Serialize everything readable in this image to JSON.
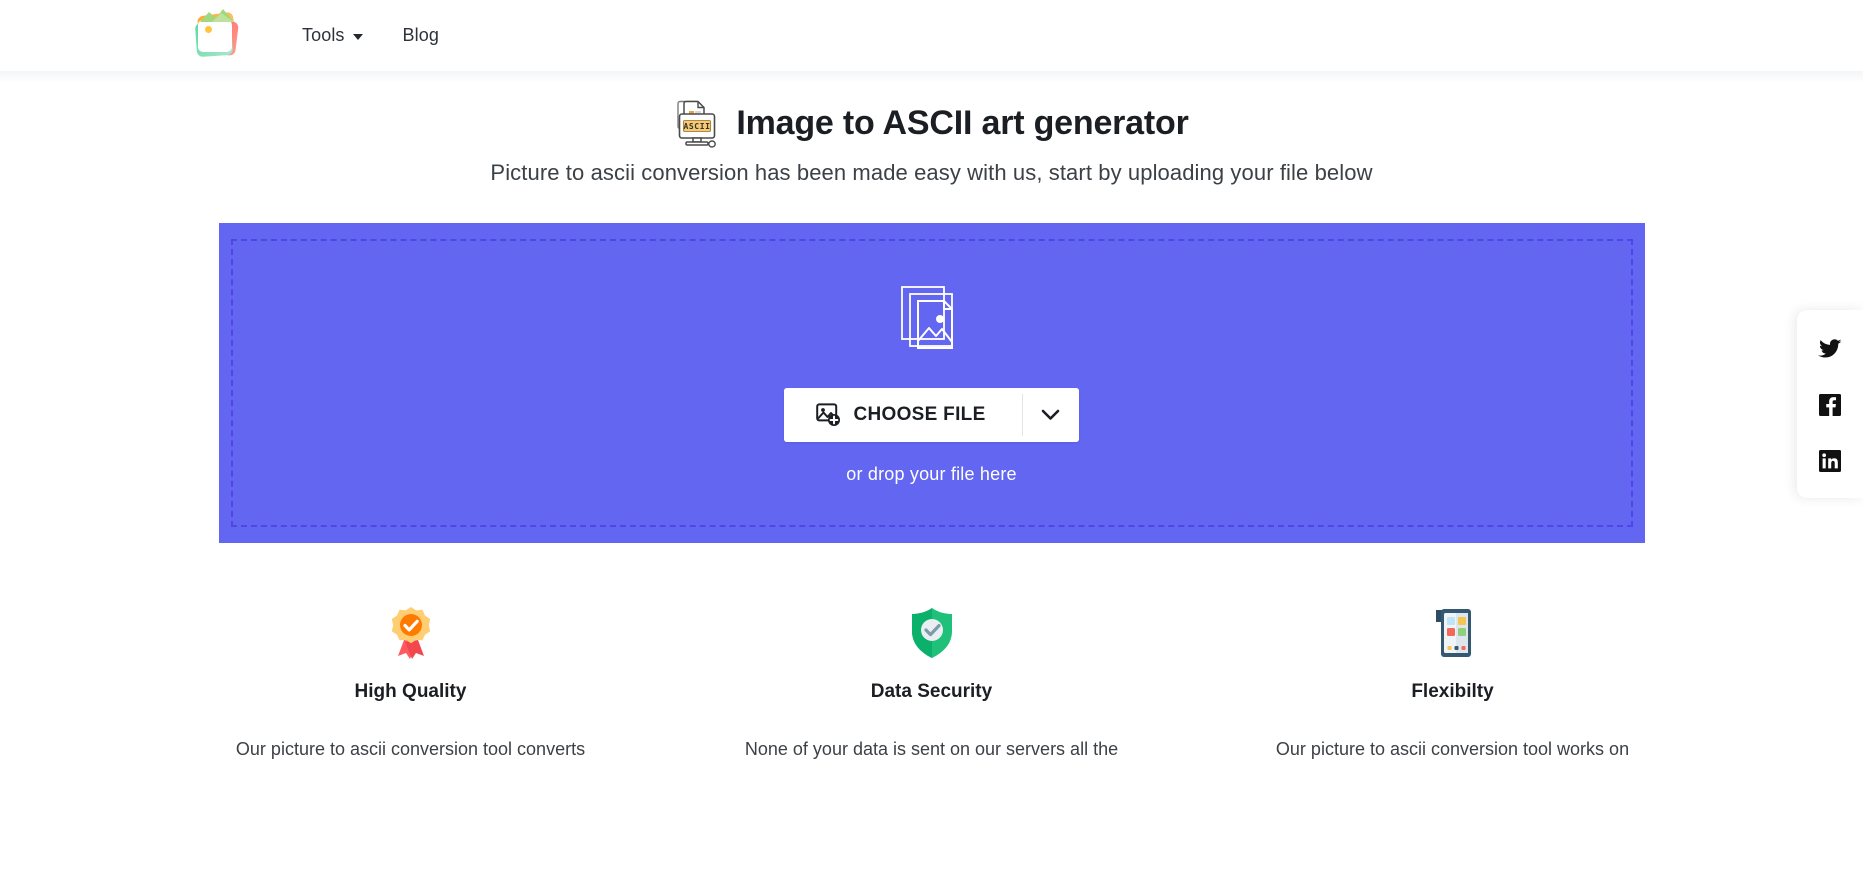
{
  "header": {
    "logo_alt": "Image tools logo",
    "nav": [
      {
        "label": "Tools",
        "has_dropdown": true
      },
      {
        "label": "Blog",
        "has_dropdown": false
      }
    ]
  },
  "hero": {
    "icon": "ascii-monitor-icon",
    "icon_text": "ASCII",
    "title": "Image to ASCII art generator",
    "subtitle": "Picture to ascii conversion has been made easy with us, start by uploading your file below"
  },
  "dropzone": {
    "icon": "image-stack-icon",
    "choose_file_label": "CHOOSE FILE",
    "dropdown_icon": "chevron-down-icon",
    "drop_hint": "or drop your file here",
    "background_color": "#6366f1",
    "border_color": "#4f46e5"
  },
  "features": [
    {
      "icon": "quality-badge-icon",
      "title": "High Quality",
      "description": "Our picture to ascii conversion tool converts"
    },
    {
      "icon": "shield-check-icon",
      "title": "Data Security",
      "description": "None of your data is sent on our servers all the"
    },
    {
      "icon": "mobile-device-icon",
      "title": "Flexibilty",
      "description": "Our picture to ascii conversion tool works on"
    }
  ],
  "social": [
    {
      "name": "twitter",
      "label": "Twitter"
    },
    {
      "name": "facebook",
      "label": "Facebook"
    },
    {
      "name": "linkedin",
      "label": "LinkedIn"
    }
  ]
}
